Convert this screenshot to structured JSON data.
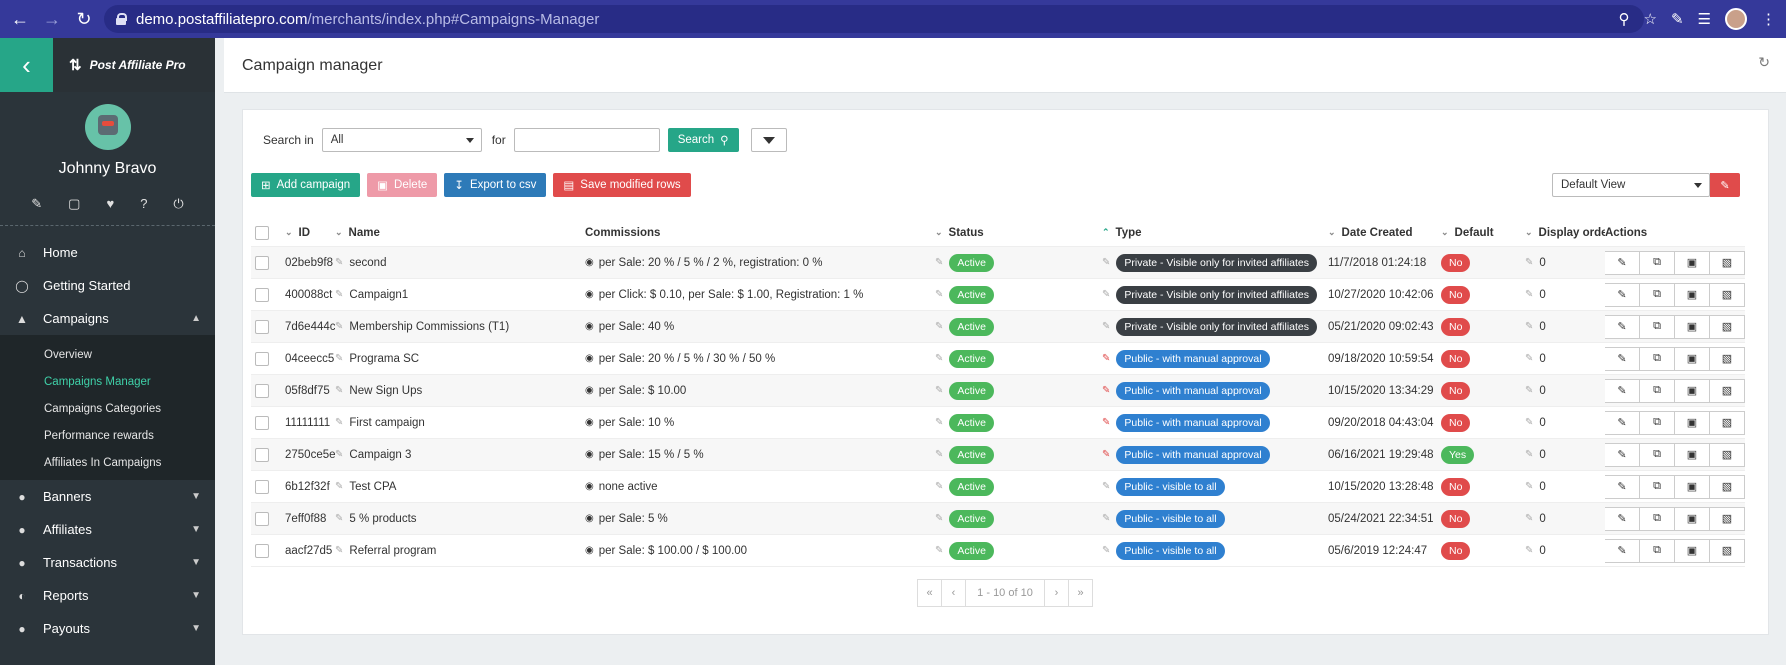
{
  "browser": {
    "url_host": "demo.postaffiliatepro.com",
    "url_path": "/merchants/index.php#Campaigns-Manager"
  },
  "sidebar": {
    "brand": "Post Affiliate Pro",
    "user_name": "Johnny Bravo",
    "nav": [
      {
        "label": "Home",
        "icon": "home-icon"
      },
      {
        "label": "Getting Started",
        "icon": "stopwatch-icon"
      },
      {
        "label": "Campaigns",
        "icon": "megaphone-icon"
      },
      {
        "label": "Banners",
        "icon": "thumbtack-icon"
      },
      {
        "label": "Affiliates",
        "icon": "users-icon"
      },
      {
        "label": "Transactions",
        "icon": "basket-icon"
      },
      {
        "label": "Reports",
        "icon": "chart-pie-icon"
      },
      {
        "label": "Payouts",
        "icon": "money-bag-icon"
      }
    ],
    "sub": [
      {
        "label": "Overview"
      },
      {
        "label": "Campaigns Manager"
      },
      {
        "label": "Campaigns Categories"
      },
      {
        "label": "Performance rewards"
      },
      {
        "label": "Affiliates In Campaigns"
      }
    ]
  },
  "header": {
    "title": "Campaign manager"
  },
  "search": {
    "label_in": "Search in",
    "scope": "All",
    "label_for": "for",
    "query": "",
    "button": "Search"
  },
  "toolbar": {
    "add": "Add campaign",
    "delete": "Delete",
    "export": "Export to csv",
    "save": "Save modified rows",
    "view": "Default View"
  },
  "columns": {
    "id": "ID",
    "name": "Name",
    "commissions": "Commissions",
    "status": "Status",
    "type": "Type",
    "date": "Date Created",
    "default": "Default",
    "order": "Display orde",
    "actions": "Actions"
  },
  "rows": [
    {
      "id": "02beb9f8",
      "name": "second",
      "com": "per Sale: 20 % / 5 % / 2 %, registration: 0 %",
      "status": "Active",
      "type": "Private - Visible only for invited affiliates",
      "type_style": "dark",
      "date": "11/7/2018 01:24:18",
      "default": "No",
      "order": "0"
    },
    {
      "id": "400088ct",
      "name": "Campaign1",
      "com": "per Click: $ 0.10, per Sale: $ 1.00, Registration: 1 %",
      "status": "Active",
      "type": "Private - Visible only for invited affiliates",
      "type_style": "dark",
      "date": "10/27/2020 10:42:06",
      "default": "No",
      "order": "0"
    },
    {
      "id": "7d6e444c",
      "name": "Membership Commissions (T1)",
      "com": "per Sale: 40 %",
      "status": "Active",
      "type": "Private - Visible only for invited affiliates",
      "type_style": "dark",
      "date": "05/21/2020 09:02:43",
      "default": "No",
      "order": "0"
    },
    {
      "id": "04ceecc5",
      "name": "Programa SC",
      "com": "per Sale: 20 % / 5 % / 30 % / 50 %",
      "status": "Active",
      "type": "Public - with manual approval",
      "type_style": "blue",
      "date": "09/18/2020 10:59:54",
      "default": "No",
      "order": "0"
    },
    {
      "id": "05f8df75",
      "name": "New Sign Ups",
      "com": "per Sale: $ 10.00",
      "status": "Active",
      "type": "Public - with manual approval",
      "type_style": "blue",
      "date": "10/15/2020 13:34:29",
      "default": "No",
      "order": "0"
    },
    {
      "id": "11111111",
      "name": "First campaign",
      "com": "per Sale: 10 %",
      "status": "Active",
      "type": "Public - with manual approval",
      "type_style": "blue",
      "date": "09/20/2018 04:43:04",
      "default": "No",
      "order": "0"
    },
    {
      "id": "2750ce5e",
      "name": "Campaign 3",
      "com": "per Sale: 15 % / 5 %",
      "status": "Active",
      "type": "Public - with manual approval",
      "type_style": "blue",
      "date": "06/16/2021 19:29:48",
      "default": "Yes",
      "order": "0"
    },
    {
      "id": "6b12f32f",
      "name": "Test CPA",
      "com": "none active",
      "status": "Active",
      "type": "Public - visible to all",
      "type_style": "blue",
      "date": "10/15/2020 13:28:48",
      "default": "No",
      "order": "0"
    },
    {
      "id": "7eff0f88",
      "name": "5 % products",
      "com": "per Sale: 5 %",
      "status": "Active",
      "type": "Public - visible to all",
      "type_style": "blue",
      "date": "05/24/2021 22:34:51",
      "default": "No",
      "order": "0"
    },
    {
      "id": "aacf27d5",
      "name": "Referral program",
      "com": "per Sale: $ 100.00 / $ 100.00",
      "status": "Active",
      "type": "Public - visible to all",
      "type_style": "blue",
      "date": "05/6/2019 12:24:47",
      "default": "No",
      "order": "0"
    }
  ],
  "pager": {
    "first": "«",
    "prev": "‹",
    "info": "1 - 10 of 10",
    "next": "›",
    "last": "»"
  },
  "colors": {
    "accent": "#26a688",
    "danger": "#e04b4b",
    "primary": "#2d7ab8",
    "browser": "#35399a"
  }
}
